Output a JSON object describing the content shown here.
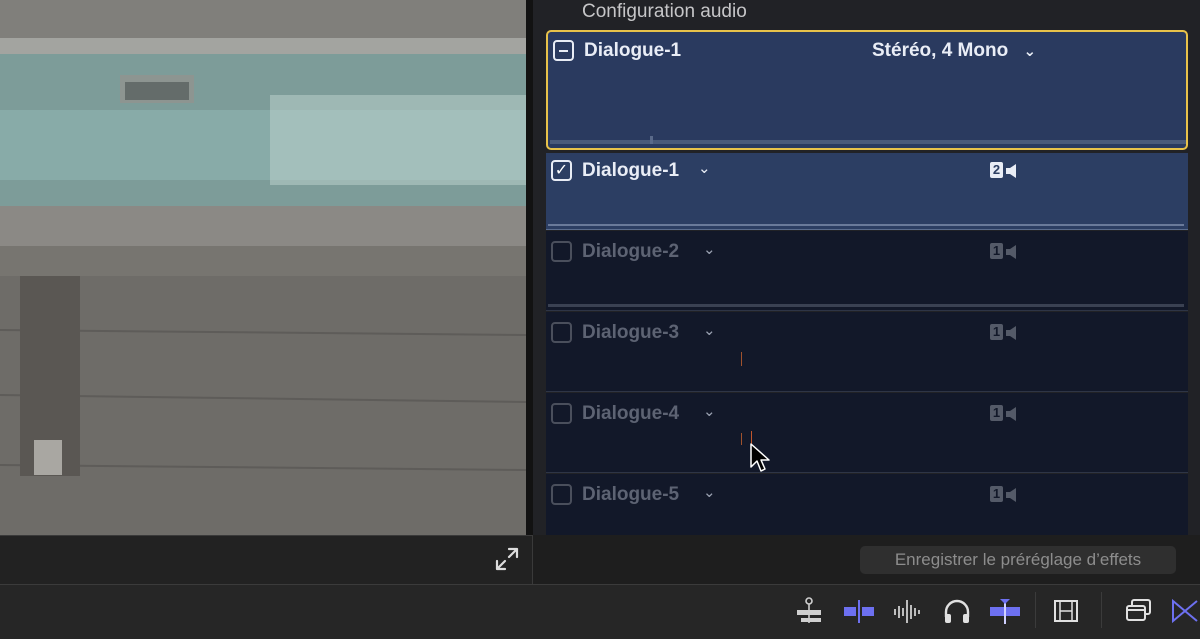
{
  "inspector": {
    "title": "Configuration audio",
    "main_clip": {
      "label": "Dialogue-1",
      "config": "Stéréo, 4 Mono",
      "state": "mixed"
    },
    "components": [
      {
        "label": "Dialogue-1",
        "channels": "2",
        "enabled": true
      },
      {
        "label": "Dialogue-2",
        "channels": "1",
        "enabled": false
      },
      {
        "label": "Dialogue-3",
        "channels": "1",
        "enabled": false
      },
      {
        "label": "Dialogue-4",
        "channels": "1",
        "enabled": false
      },
      {
        "label": "Dialogue-5",
        "channels": "1",
        "enabled": false
      }
    ],
    "save_preset_label": "Enregistrer le préréglage d’effets"
  },
  "colors": {
    "highlight_border": "#e8c24a",
    "active_row": "#2c3e63",
    "inactive_row": "#121829",
    "toolbar_accent": "#6d70f0"
  },
  "icons": {
    "fullscreen": "expand-arrows-icon",
    "chevron": "chevron-down-icon",
    "speaker": "speaker-icon",
    "toolbar": [
      "clip-connections-icon",
      "snapping-icon",
      "audio-skimming-icon",
      "solo-headphones-icon",
      "skimming-icon",
      "clip-appearance-icon",
      "overlapped-windows-icon",
      "transitions-icon"
    ]
  }
}
